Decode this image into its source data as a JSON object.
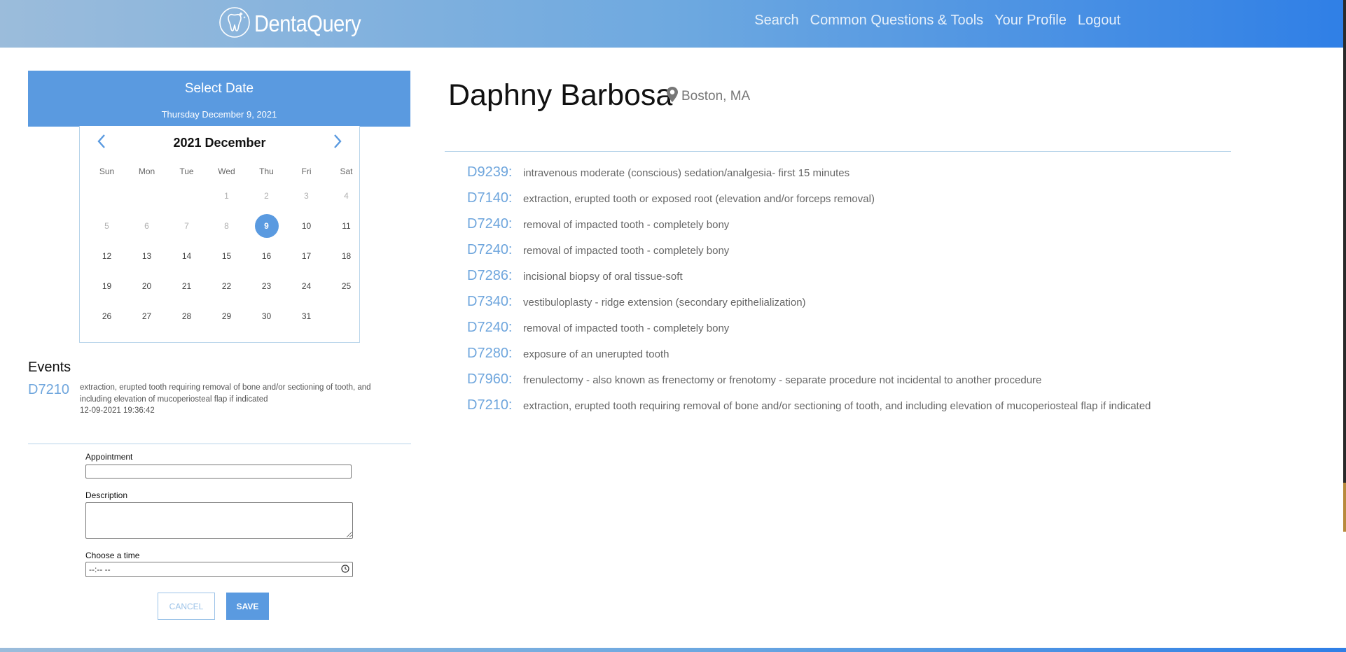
{
  "header": {
    "brand": "DentaQuery",
    "nav": [
      "Search",
      "Common Questions & Tools",
      "Your Profile",
      "Logout"
    ]
  },
  "calendar": {
    "title": "Select Date",
    "selected_date_label": "Thursday December 9, 2021",
    "month_label": "2021 December",
    "weekdays": [
      "Sun",
      "Mon",
      "Tue",
      "Wed",
      "Thu",
      "Fri",
      "Sat"
    ],
    "weeks": [
      [
        "",
        "",
        "",
        "1",
        "2",
        "3",
        "4"
      ],
      [
        "5",
        "6",
        "7",
        "8",
        "9",
        "10",
        "11"
      ],
      [
        "12",
        "13",
        "14",
        "15",
        "16",
        "17",
        "18"
      ],
      [
        "19",
        "20",
        "21",
        "22",
        "23",
        "24",
        "25"
      ],
      [
        "26",
        "27",
        "28",
        "29",
        "30",
        "31",
        ""
      ]
    ],
    "selected_day": "9",
    "disabled_through": "8"
  },
  "events": {
    "title": "Events",
    "items": [
      {
        "code": "D7210",
        "description": "extraction, erupted tooth requiring removal of bone and/or sectioning of tooth, and including elevation of mucoperiosteal flap if indicated",
        "timestamp": "12-09-2021 19:36:42"
      }
    ]
  },
  "form": {
    "appointment_label": "Appointment",
    "appointment_value": "",
    "description_label": "Description",
    "description_value": "",
    "time_label": "Choose a time",
    "time_value": "--:-- --",
    "cancel_label": "CANCEL",
    "save_label": "SAVE"
  },
  "patient": {
    "name": "Daphny Barbosa",
    "location": "Boston, MA"
  },
  "procedures": [
    {
      "code": "D9239:",
      "description": "intravenous moderate (conscious) sedation/analgesia- first 15 minutes"
    },
    {
      "code": "D7140:",
      "description": "extraction, erupted tooth or exposed root (elevation and/or forceps removal)"
    },
    {
      "code": "D7240:",
      "description": "removal of impacted tooth - completely bony"
    },
    {
      "code": "D7240:",
      "description": "removal of impacted tooth - completely bony"
    },
    {
      "code": "D7286:",
      "description": "incisional biopsy of oral tissue-soft"
    },
    {
      "code": "D7340:",
      "description": "vestibuloplasty - ridge extension (secondary epithelialization)"
    },
    {
      "code": "D7240:",
      "description": "removal of impacted tooth - completely bony"
    },
    {
      "code": "D7280:",
      "description": "exposure of an unerupted tooth"
    },
    {
      "code": "D7960:",
      "description": "frenulectomy - also known as frenectomy or frenotomy - separate procedure not incidental to another procedure"
    },
    {
      "code": "D7210:",
      "description": "extraction, erupted tooth requiring removal of bone and/or sectioning of tooth, and including elevation of mucoperiosteal flap if indicated"
    }
  ],
  "colors": {
    "accent": "#5a9ae0",
    "code_text": "#6fa6dd",
    "header_gradient_start": "#9bbcdb",
    "header_gradient_end": "#2f7fe6"
  },
  "icons": {
    "logo": "tooth-logo-icon",
    "prev": "chevron-left-icon",
    "next": "chevron-right-icon",
    "location": "map-pin-icon",
    "time": "clock-icon"
  }
}
